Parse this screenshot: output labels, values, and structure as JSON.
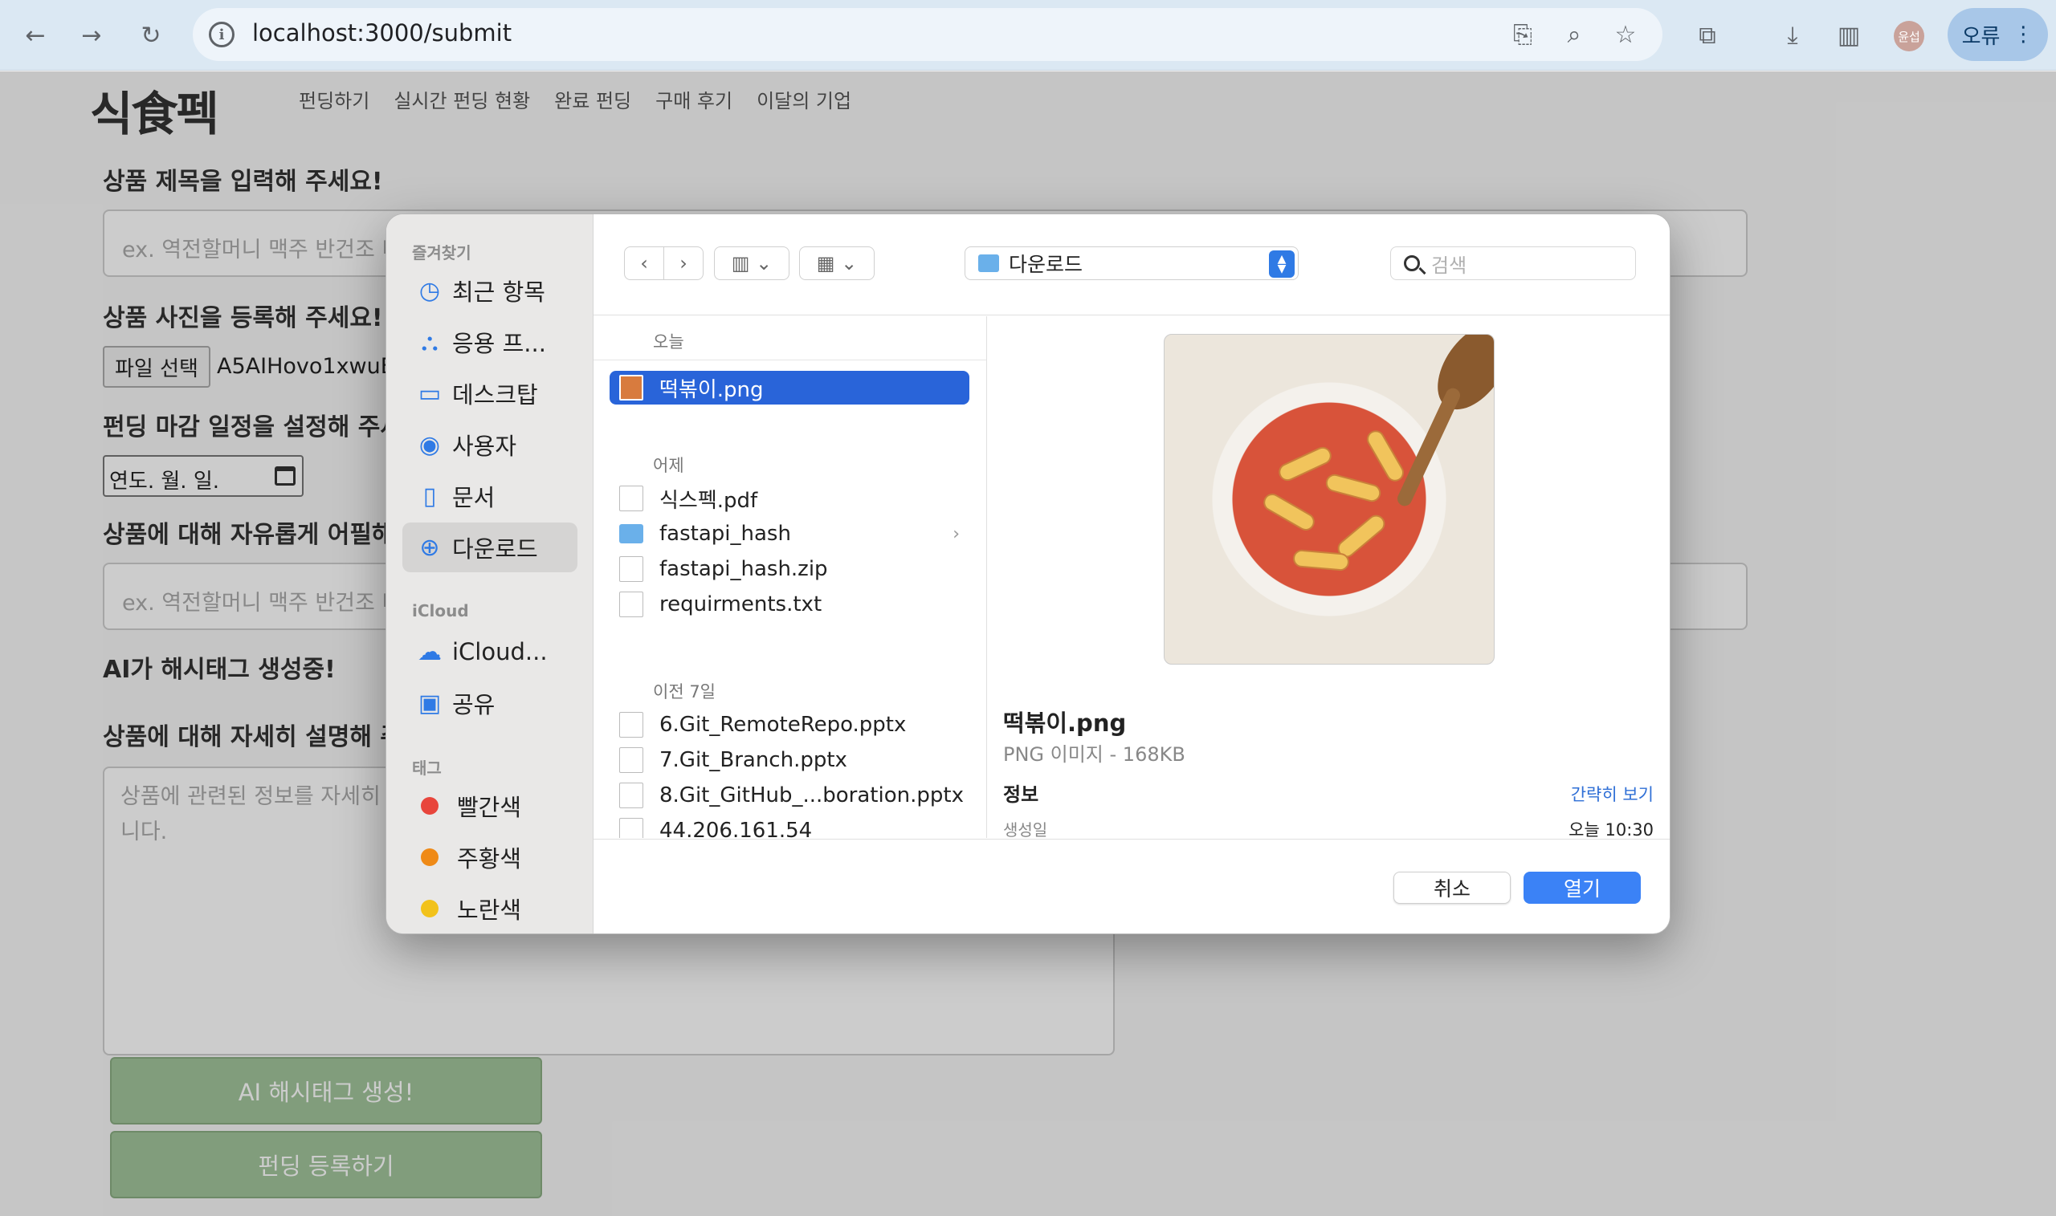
{
  "browser": {
    "url": "localhost:3000/submit",
    "profile_initials": "윤섭",
    "error_label": "오류"
  },
  "site": {
    "logo": "식食펙",
    "nav": [
      "펀딩하기",
      "실시간 펀딩 현황",
      "완료 펀딩",
      "구매 후기",
      "이달의 기업"
    ]
  },
  "form": {
    "title_label": "상품 제목을 입력해 주세요!",
    "title_placeholder": "ex. 역전할머니 맥주 반건조 비",
    "photo_label": "상품 사진을 등록해 주세요!",
    "file_button": "파일 선택",
    "file_name": "A5AIHovo1xwuE",
    "deadline_label": "펀딩 마감 일정을 설정해 주세",
    "date_placeholder": "연도. 월. 일.",
    "appeal_label": "상품에 대해 자유롭게 어필해",
    "appeal_placeholder": "ex. 역전할머니 맥주 반건조 비",
    "hashtag_status": "AI가 해시태그 생성중!",
    "desc_label": "상품에 대해 자세히 설명해 주",
    "desc_placeholder_line1": "상품에 관련된 정보를 자세히",
    "desc_placeholder_line2": "니다.",
    "ai_button": "AI 해시태그 생성!",
    "submit_button": "펀딩 등록하기"
  },
  "dialog": {
    "sidebar": {
      "favorites_header": "즐겨찾기",
      "favorites": [
        {
          "label": "최근 항목",
          "icon": "clock-icon"
        },
        {
          "label": "응용 프...",
          "icon": "apps-icon"
        },
        {
          "label": "데스크탑",
          "icon": "desktop-icon"
        },
        {
          "label": "사용자",
          "icon": "user-icon"
        },
        {
          "label": "문서",
          "icon": "document-icon"
        },
        {
          "label": "다운로드",
          "icon": "download-icon"
        }
      ],
      "icloud_header": "iCloud",
      "icloud": [
        {
          "label": "iCloud...",
          "icon": "cloud-icon"
        },
        {
          "label": "공유",
          "icon": "shared-folder-icon"
        }
      ],
      "tags_header": "태그",
      "tags": [
        {
          "label": "빨간색",
          "color": "#e8453c"
        },
        {
          "label": "주황색",
          "color": "#ef8a17"
        },
        {
          "label": "노란색",
          "color": "#f2c21b"
        }
      ]
    },
    "location": "다운로드",
    "search_placeholder": "검색",
    "sections": {
      "today": "오늘",
      "yesterday": "어제",
      "prev7": "이전 7일"
    },
    "files_today": [
      "떡볶이.png"
    ],
    "files_yesterday": [
      "식스펙.pdf",
      "fastapi_hash",
      "fastapi_hash.zip",
      "requirments.txt"
    ],
    "files_prev7": [
      "6.Git_RemoteRepo.pptx",
      "7.Git_Branch.pptx",
      "8.Git_GitHub_...boration.pptx",
      "44.206.161.54"
    ],
    "preview": {
      "name": "떡볶이.png",
      "meta": "PNG 이미지 - 168KB",
      "info_label": "정보",
      "less_label": "간략히 보기",
      "created_label": "생성일",
      "created_value": "오늘 10:30"
    },
    "cancel": "취소",
    "open": "열기"
  }
}
